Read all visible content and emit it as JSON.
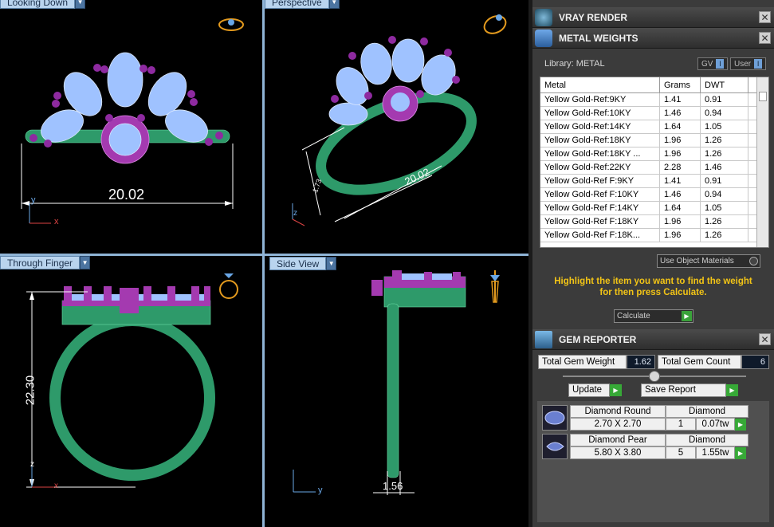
{
  "viewports": {
    "top_left": {
      "label": "Looking Down",
      "dimension": "20.02"
    },
    "top_right": {
      "label": "Perspective",
      "dimension": "20.02",
      "small_dimension": "1.73"
    },
    "bottom_left": {
      "label": "Through Finger",
      "dimension": "22.30"
    },
    "bottom_right": {
      "label": "Side View",
      "dimension": "1.56"
    },
    "axis_x": "x",
    "axis_y": "y",
    "axis_z": "z"
  },
  "panels": {
    "vray": {
      "title": "VRAY RENDER"
    },
    "metal": {
      "title": "METAL WEIGHTS",
      "library_label": "Library: METAL",
      "toggle_gv": "GV",
      "toggle_user": "User",
      "toggle_mark": "I",
      "columns": [
        "Metal",
        "Grams",
        "DWT"
      ],
      "rows": [
        [
          "Yellow Gold-Ref:9KY",
          "1.41",
          "0.91"
        ],
        [
          "Yellow Gold-Ref:10KY",
          "1.46",
          "0.94"
        ],
        [
          "Yellow Gold-Ref:14KY",
          "1.64",
          "1.05"
        ],
        [
          "Yellow Gold-Ref:18KY",
          "1.96",
          "1.26"
        ],
        [
          "Yellow Gold-Ref:18KY ...",
          "1.96",
          "1.26"
        ],
        [
          "Yellow Gold-Ref:22KY",
          "2.28",
          "1.46"
        ],
        [
          "Yellow Gold-Ref F:9KY",
          "1.41",
          "0.91"
        ],
        [
          "Yellow Gold-Ref F:10KY",
          "1.46",
          "0.94"
        ],
        [
          "Yellow Gold-Ref F:14KY",
          "1.64",
          "1.05"
        ],
        [
          "Yellow Gold-Ref F:18KY",
          "1.96",
          "1.26"
        ],
        [
          "Yellow Gold-Ref F:18K...",
          "1.96",
          "1.26"
        ]
      ],
      "use_object_materials": "Use Object Materials",
      "hint_line1": "Highlight the item you want to find the weight",
      "hint_line2": "for then press Calculate.",
      "calculate": "Calculate"
    },
    "gem": {
      "title": "GEM REPORTER",
      "total_weight_label": "Total Gem Weight",
      "total_weight_value": "1.62",
      "total_count_label": "Total Gem Count",
      "total_count_value": "6",
      "update": "Update",
      "save_report": "Save Report",
      "gems": [
        {
          "name": "Diamond Round",
          "size": "2.70 X 2.70",
          "material": "Diamond",
          "count": "1",
          "weight": "0.07tw"
        },
        {
          "name": "Diamond Pear",
          "size": "5.80 X 3.80",
          "material": "Diamond",
          "count": "5",
          "weight": "1.55tw"
        }
      ]
    }
  },
  "colors": {
    "band": "#2e9a6a",
    "gem": "#9fc2ff",
    "prong": "#a43ab0",
    "dimension": "#ffffff",
    "hint": "#f2c416",
    "viewport_label": "#b9d4ee"
  }
}
